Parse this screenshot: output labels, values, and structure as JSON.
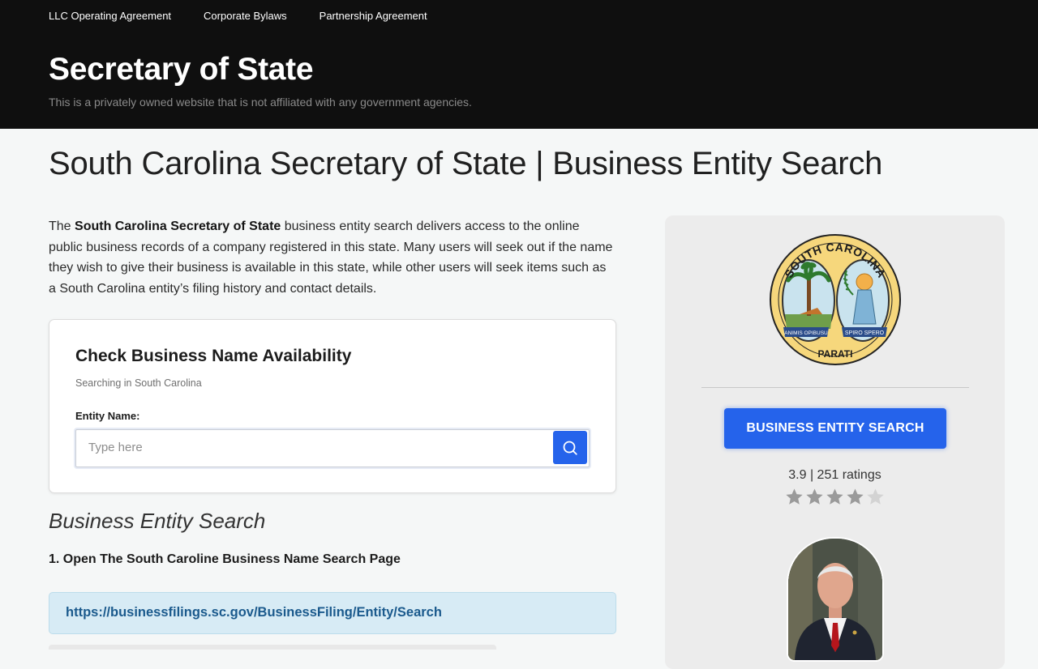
{
  "nav": {
    "items": [
      "LLC Operating Agreement",
      "Corporate Bylaws",
      "Partnership Agreement"
    ]
  },
  "header": {
    "site_title": "Secretary of State",
    "tagline": "This is a privately owned website that is not affiliated with any government agencies."
  },
  "main": {
    "page_title": "South Carolina Secretary of State | Business Entity Search",
    "intro": {
      "lead": "The ",
      "bold": "South Carolina Secretary of State",
      "rest": " business entity search delivers access to the online public business records of a company registered in this state. Many users will seek out if the name they wish to give their business is available in this state, while other users will seek items such as a South Carolina entity’s filing history and contact details."
    },
    "search_card": {
      "title": "Check Business Name Availability",
      "subtitle": "Searching in South Carolina",
      "field_label": "Entity Name:",
      "placeholder": "Type here",
      "value": ""
    },
    "section_heading": "Business Entity Search",
    "step1": "1. Open The South Caroline Business Name Search Page",
    "link": "https://businessfilings.sc.gov/BusinessFiling/Entity/Search"
  },
  "sidebar": {
    "seal": {
      "top_text": "SOUTH CAROLINA",
      "left_motto": "ANIMIS OPIBUSU",
      "right_motto": "SPIRO SPERO",
      "bottom_text": "PARATI"
    },
    "cta_label": "BUSINESS ENTITY SEARCH",
    "rating_text": "3.9 | 251 ratings",
    "rating": {
      "value": 4,
      "max": 5
    }
  },
  "colors": {
    "accent": "#2563eb",
    "header_bg": "#0f0f0f",
    "link": "#1b5a8d",
    "link_box_bg": "#d7ebf5",
    "star_filled": "#9a9a9a",
    "star_empty": "#d3d3d3"
  }
}
